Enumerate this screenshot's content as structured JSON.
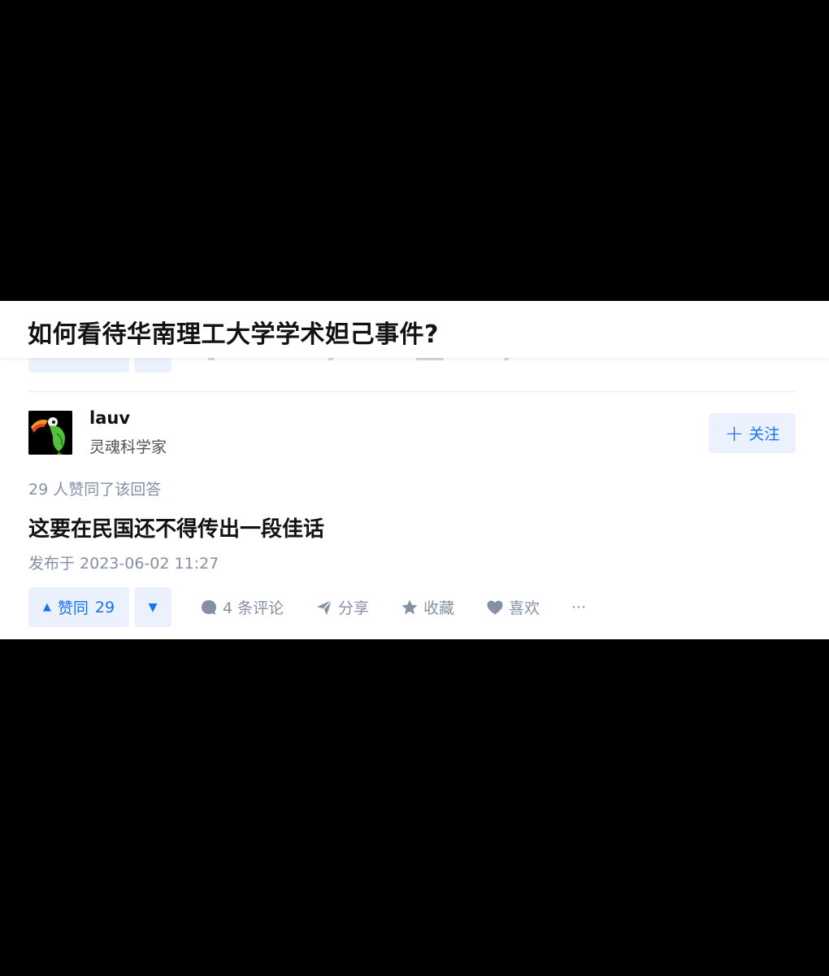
{
  "header": {
    "question_title": "如何看待华南理工大学学术妲己事件?"
  },
  "answer": {
    "author": {
      "name": "lauv",
      "headline": "灵魂科学家",
      "avatar_icon": "parrot-avatar"
    },
    "follow_label": "关注",
    "vote_summary": "29 人赞同了该回答",
    "content": "这要在民国还不得传出一段佳话",
    "publish_time": "发布于 2023-06-02 11:27",
    "actions": {
      "vote_up_label": "赞同",
      "vote_up_count": "29",
      "comments_label": "4 条评论",
      "share_label": "分享",
      "collect_label": "收藏",
      "like_label": "喜欢",
      "more_label": "···"
    }
  },
  "colors": {
    "brand_blue": "#1772f6",
    "vote_bg": "#ebf2fd",
    "meta_gray": "#8590a6",
    "text_dark": "#121212",
    "backdrop": "#000000"
  }
}
